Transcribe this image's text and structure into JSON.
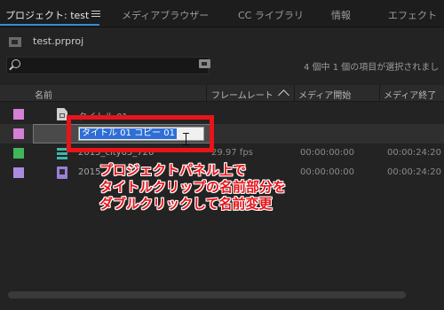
{
  "tabs": [
    {
      "label": "プロジェクト: test",
      "active": true
    },
    {
      "label": "メディアブラウザー"
    },
    {
      "label": "CC ライブラリ"
    },
    {
      "label": "情報"
    },
    {
      "label": "エフェクト"
    }
  ],
  "project": {
    "file_name": "test.prproj"
  },
  "search": {
    "placeholder": ""
  },
  "status_text": "4 個中 1 個の項目が選択されまし",
  "columns": {
    "name": "名前",
    "frame_rate": "フレームレート",
    "media_start": "メディア開始",
    "media_end": "メディア終了"
  },
  "rows": [
    {
      "color": "#d67fd6",
      "icon": "title-file-icon",
      "name": "タイトル 01",
      "frame_rate": "",
      "media_start": "",
      "media_end": ""
    },
    {
      "color": "#d67fd6",
      "icon": "title-file-icon",
      "name": "タイトル 01 コピー 01",
      "frame_rate": "",
      "media_start": "",
      "media_end": "",
      "editing": true
    },
    {
      "color": "#3fb75a",
      "icon": "sequence-icon",
      "name": "2015_city05_720",
      "frame_rate": "29.97 fps",
      "media_start": "00:00:00:00",
      "media_end": "00:00:24:20"
    },
    {
      "color": "#a98ce0",
      "icon": "video-clip-icon",
      "name": "2015",
      "frame_rate": "",
      "media_start": "00:00:00:00",
      "media_end": "00:00:24:20"
    }
  ],
  "editing_value": "タイトル 01 コピー 01",
  "annotation": {
    "lines": [
      "プロジェクトパネル上で",
      "タイトルクリップの名前部分を",
      "ダブルクリックして名前変更"
    ],
    "color": "#e8141a"
  }
}
